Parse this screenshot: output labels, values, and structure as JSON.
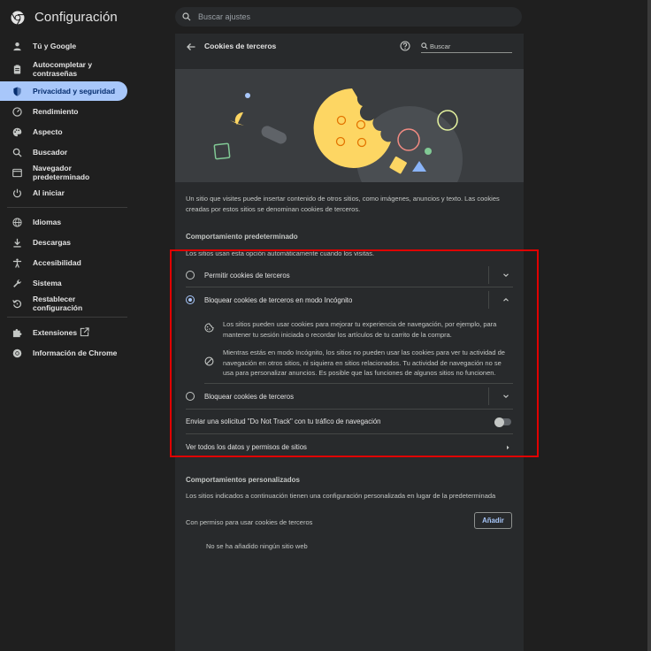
{
  "app": {
    "title": "Configuración"
  },
  "search": {
    "placeholder": "Buscar ajustes"
  },
  "sidebar": {
    "items": [
      {
        "label": "Tú y Google",
        "icon": "person-icon"
      },
      {
        "label": "Autocompletar y contraseñas",
        "icon": "clipboard-icon"
      },
      {
        "label": "Privacidad y seguridad",
        "icon": "shield-icon",
        "active": true
      },
      {
        "label": "Rendimiento",
        "icon": "speedometer-icon"
      },
      {
        "label": "Aspecto",
        "icon": "palette-icon"
      },
      {
        "label": "Buscador",
        "icon": "search-icon"
      },
      {
        "label": "Navegador predeterminado",
        "icon": "browser-icon"
      },
      {
        "label": "Al iniciar",
        "icon": "power-icon"
      },
      {
        "label": "Idiomas",
        "icon": "globe-icon"
      },
      {
        "label": "Descargas",
        "icon": "download-icon"
      },
      {
        "label": "Accesibilidad",
        "icon": "accessibility-icon"
      },
      {
        "label": "Sistema",
        "icon": "wrench-icon"
      },
      {
        "label": "Restablecer configuración",
        "icon": "reset-icon"
      },
      {
        "label": "Extensiones",
        "icon": "puzzle-icon"
      },
      {
        "label": "Información de Chrome",
        "icon": "chrome-icon"
      }
    ]
  },
  "page": {
    "title": "Cookies de terceros",
    "search_placeholder": "Buscar",
    "intro": "Un sitio que visites puede insertar contenido de otros sitios, como imágenes, anuncios y texto. Las cookies creadas por estos sitios se denominan cookies de terceros.",
    "default_behavior": {
      "title": "Comportamiento predeterminado",
      "subtitle": "Los sitios usan esta opción automáticamente cuando los visitas.",
      "options": [
        {
          "label": "Permitir cookies de terceros",
          "checked": false
        },
        {
          "label": "Bloquear cookies de terceros en modo Incógnito",
          "checked": true
        },
        {
          "label": "Bloquear cookies de terceros",
          "checked": false
        }
      ],
      "details": [
        "Los sitios pueden usar cookies para mejorar tu experiencia de navegación, por ejemplo, para mantener tu sesión iniciada o recordar los artículos de tu carrito de la compra.",
        "Mientras estás en modo Incógnito, los sitios no pueden usar las cookies para ver tu actividad de navegación en otros sitios, ni siquiera en sitios relacionados. Tu actividad de navegación no se usa para personalizar anuncios. Es posible que las funciones de algunos sitios no funcionen."
      ],
      "dnt_label": "Enviar una solicitud \"Do Not Track\" con tu tráfico de navegación",
      "dnt_enabled": false,
      "all_data_label": "Ver todos los datos y permisos de sitios"
    },
    "custom": {
      "title": "Comportamientos personalizados",
      "subtitle": "Los sitios indicados a continuación tienen una configuración personalizada en lugar de la predeterminada",
      "allowed_label": "Con permiso para usar cookies de terceros",
      "add_button": "Añadir",
      "empty": "No se ha añadido ningún sitio web"
    }
  },
  "colors": {
    "accent": "#a8c7fa",
    "highlight": "#e00000",
    "background": "#1f1f1f",
    "card": "#282a2c"
  }
}
